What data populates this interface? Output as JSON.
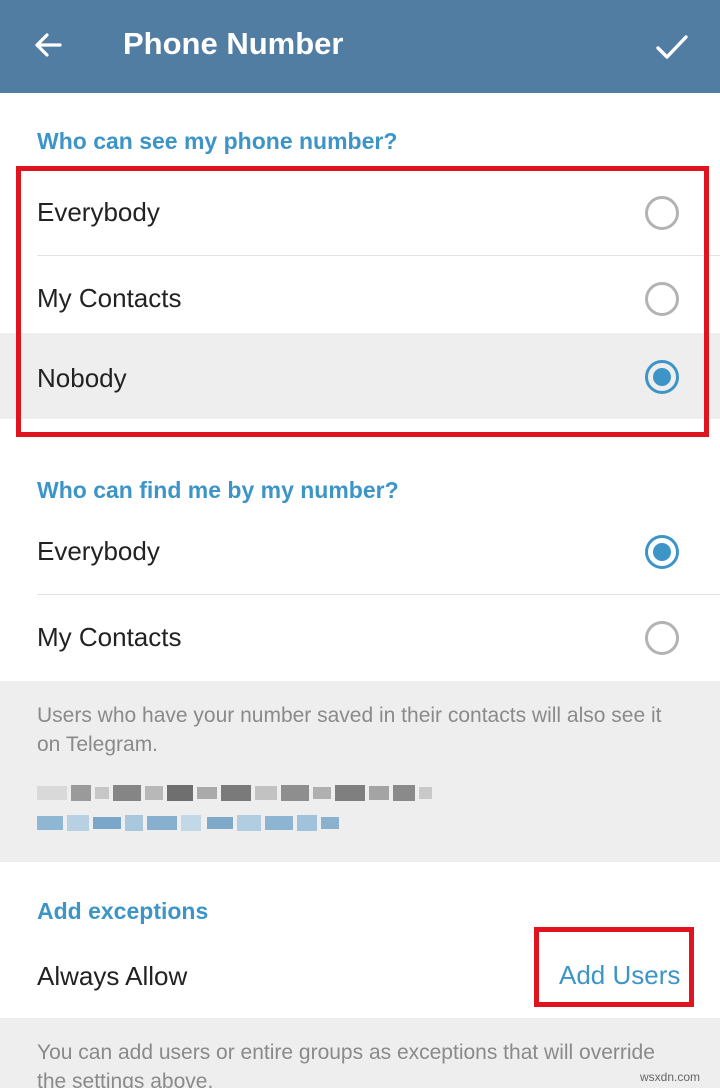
{
  "appbar": {
    "title": "Phone Number",
    "back_icon": "arrow-left-icon",
    "confirm_icon": "check-icon"
  },
  "see_section": {
    "header": "Who can see my phone number?",
    "options": [
      {
        "label": "Everybody",
        "selected": false
      },
      {
        "label": "My Contacts",
        "selected": false
      },
      {
        "label": "Nobody",
        "selected": true
      }
    ]
  },
  "find_section": {
    "header": "Who can find me by my number?",
    "options": [
      {
        "label": "Everybody",
        "selected": true
      },
      {
        "label": "My Contacts",
        "selected": false
      }
    ],
    "info": "Users who have your number saved in their contacts will also see it on Telegram."
  },
  "exceptions": {
    "header": "Add exceptions",
    "row_label": "Always Allow",
    "action_label": "Add Users",
    "info": "You can add users or entire groups as exceptions that will override the settings above."
  },
  "watermark": "wsxdn.com",
  "colors": {
    "appbar": "#527da3",
    "accent": "#3d95c7",
    "highlight": "#e0141e"
  }
}
